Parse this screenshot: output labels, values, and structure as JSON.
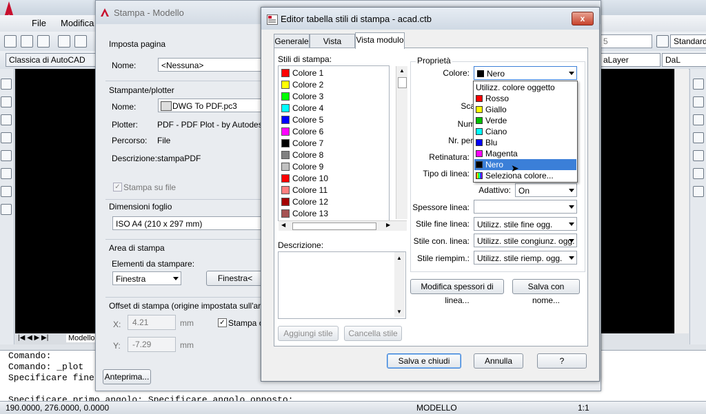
{
  "acad": {
    "menu": [
      "File",
      "Modifica"
    ],
    "workspace": "Classica di AutoCAD",
    "text_style": "Standard",
    "layer_label": "aLayer",
    "linetype_label": "DaL",
    "toolbar_number": "5",
    "layout_tab": "Modello",
    "command_lines": [
      "Comando:",
      "Comando: _plot",
      "Specificare fine",
      "",
      "Specificare primo angolo: Specificare angolo opposto:"
    ],
    "coordinates": "190.0000, 276.0000, 0.0000",
    "status_model": "MODELLO",
    "scale": "1:1"
  },
  "plot": {
    "title": "Stampa - Modello",
    "page_setup": {
      "heading": "Imposta pagina",
      "name_label": "Nome:",
      "name_value": "<Nessuna>"
    },
    "printer": {
      "heading": "Stampante/plotter",
      "name_label": "Nome:",
      "name_value": "DWG To PDF.pc3",
      "plotter_label": "Plotter:",
      "plotter_value": "PDF - PDF Plot - by Autodesk",
      "path_label": "Percorso:",
      "path_value": "File",
      "desc_label": "Descrizione:",
      "desc_value": "stampaPDF",
      "plot_to_file": "Stampa su file"
    },
    "paper": {
      "heading": "Dimensioni foglio",
      "value": "ISO A4 (210 x 297 mm)"
    },
    "area": {
      "heading": "Area di stampa",
      "what_label": "Elementi da stampare:",
      "what_value": "Finestra",
      "window_button": "Finestra<"
    },
    "offset": {
      "heading": "Offset di stampa (origine impostata sull'area di",
      "x_label": "X:",
      "x_value": "4.21",
      "x_unit": "mm",
      "y_label": "Y:",
      "y_value": "-7.29",
      "y_unit": "mm",
      "center_label": "Stampa ce"
    },
    "preview_button": "Anteprima..."
  },
  "editor": {
    "title": "Editor tabella stili di stampa - acad.ctb",
    "close_glyph": "x",
    "tabs": [
      "Generale",
      "Vista tabella",
      "Vista modulo"
    ],
    "styles_heading": "Stili di stampa:",
    "styles": [
      {
        "label": "Colore 1",
        "color": "#ff0000"
      },
      {
        "label": "Colore 2",
        "color": "#ffff00"
      },
      {
        "label": "Colore 3",
        "color": "#00ff00"
      },
      {
        "label": "Colore 4",
        "color": "#00ffff"
      },
      {
        "label": "Colore 5",
        "color": "#0000ff"
      },
      {
        "label": "Colore 6",
        "color": "#ff00ff"
      },
      {
        "label": "Colore 7",
        "color": "#000000"
      },
      {
        "label": "Colore 8",
        "color": "#808080"
      },
      {
        "label": "Colore 9",
        "color": "#c0c0c0"
      },
      {
        "label": "Colore 10",
        "color": "#ff0000"
      },
      {
        "label": "Colore 11",
        "color": "#ff7f7f"
      },
      {
        "label": "Colore 12",
        "color": "#a50000"
      },
      {
        "label": "Colore 13",
        "color": "#a55252"
      }
    ],
    "description_label": "Descrizione:",
    "add_style": "Aggiungi stile",
    "delete_style": "Cancella stile",
    "properties_heading": "Proprietà",
    "color_label": "Colore:",
    "color_value": "Nero",
    "partial_labels": [
      "Sca",
      "Num",
      "Nr. pen"
    ],
    "screening_label": "Retinatura:",
    "linetype_label": "Tipo di linea:",
    "adaptive_label": "Adattivo:",
    "adaptive_value": "On",
    "lineweight_label": "Spessore linea:",
    "lineweight_value": "",
    "line_end_label": "Stile fine linea:",
    "line_end_value": "Utilizz. stile fine ogg.",
    "line_join_label": "Stile con. linea:",
    "line_join_value": "Utilizz. stile congiunz. ogg.",
    "fill_label": "Stile riempim.:",
    "fill_value": "Utilizz. stile riemp. ogg.",
    "edit_lineweights": "Modifica spessori di linea...",
    "save_as": "Salva con nome...",
    "save_close": "Salva e chiudi",
    "cancel": "Annulla",
    "help": "?",
    "color_options": [
      {
        "label": "Utilizz. colore oggetto",
        "color": ""
      },
      {
        "label": "Rosso",
        "color": "#ff0000"
      },
      {
        "label": "Giallo",
        "color": "#ffff00"
      },
      {
        "label": "Verde",
        "color": "#00c000"
      },
      {
        "label": "Ciano",
        "color": "#00ffff"
      },
      {
        "label": "Blu",
        "color": "#0000ff"
      },
      {
        "label": "Magenta",
        "color": "#ff00ff"
      },
      {
        "label": "Nero",
        "color": "#000000"
      },
      {
        "label": "Seleziona colore...",
        "color": "multi"
      }
    ],
    "selected_option": "Nero"
  }
}
